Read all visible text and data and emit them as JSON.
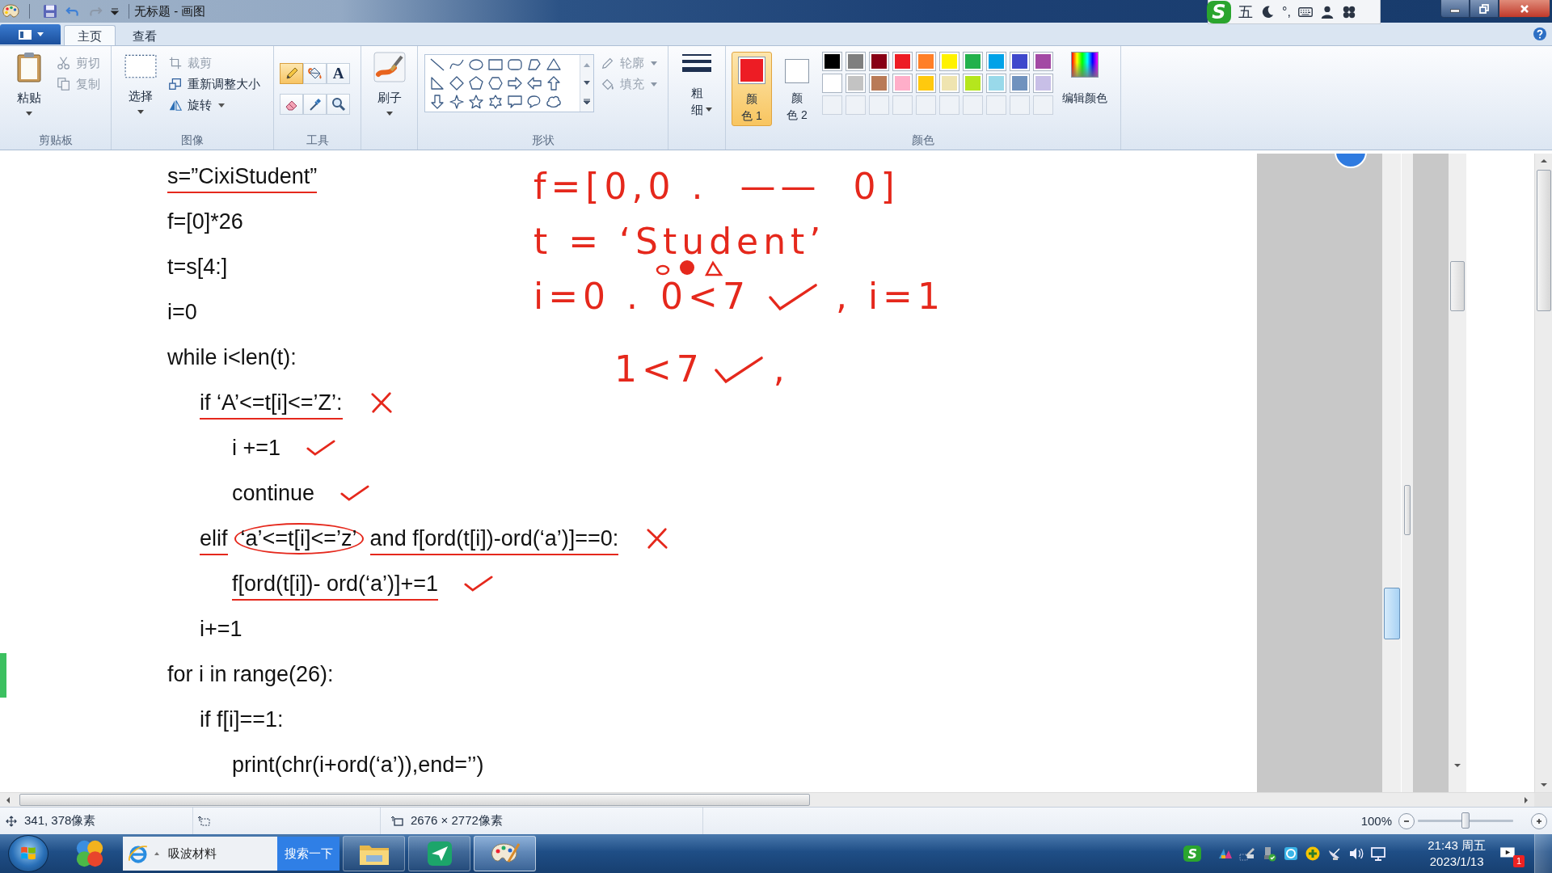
{
  "window": {
    "title": "无标题 - 画图"
  },
  "ime_bar": {
    "logo": "S",
    "mode": "五",
    "punctuation": "°,"
  },
  "tabs": [
    {
      "label": "主页",
      "selected": true
    },
    {
      "label": "查看",
      "selected": false
    }
  ],
  "ribbon": {
    "clipboard": {
      "paste": "粘贴",
      "items": [
        {
          "label": "剪切",
          "disabled": true,
          "dropdown": false
        },
        {
          "label": "复制",
          "disabled": true,
          "dropdown": false
        }
      ],
      "group": "剪贴板"
    },
    "image": {
      "select": "选择",
      "items": [
        {
          "label": "裁剪",
          "disabled": true,
          "dropdown": false
        },
        {
          "label": "重新调整大小",
          "disabled": false,
          "dropdown": false
        },
        {
          "label": "旋转",
          "disabled": false,
          "dropdown": true
        }
      ],
      "group": "图像"
    },
    "tools": {
      "items": [
        {
          "selected": true
        },
        {
          "selected": false
        },
        {
          "label": "A",
          "selected": false
        },
        {
          "selected": false
        },
        {
          "selected": false
        },
        {
          "selected": false
        }
      ],
      "group": "工具"
    },
    "brushes": {
      "label": "刷子"
    },
    "shapes": {
      "items": [
        {
          "label": "轮廓",
          "disabled": true,
          "dropdown": true
        },
        {
          "label": "填充",
          "disabled": true,
          "dropdown": true
        }
      ],
      "group": "形状"
    },
    "size": {
      "label": "粗细"
    },
    "colors": {
      "slots": [
        {
          "label": "颜色 1",
          "color": "#ed1c24",
          "selected": true
        },
        {
          "label": "颜色 2",
          "color": "#ffffff",
          "selected": false
        }
      ],
      "palette": [
        {
          "color": "#000000"
        },
        {
          "color": "#7f7f7f"
        },
        {
          "color": "#880015"
        },
        {
          "color": "#ed1c24"
        },
        {
          "color": "#ff7f27"
        },
        {
          "color": "#fff200"
        },
        {
          "color": "#22b14c"
        },
        {
          "color": "#00a2e8"
        },
        {
          "color": "#3f48cc"
        },
        {
          "color": "#a349a4"
        },
        {
          "color": "#ffffff"
        },
        {
          "color": "#c3c3c3"
        },
        {
          "color": "#b97a57"
        },
        {
          "color": "#ffaec9"
        },
        {
          "color": "#ffc90e"
        },
        {
          "color": "#efe4b0"
        },
        {
          "color": "#b5e61d"
        },
        {
          "color": "#99d9ea"
        },
        {
          "color": "#7092be"
        },
        {
          "color": "#c8bfe7"
        }
      ],
      "edit": "编辑颜色",
      "group": "颜色"
    }
  },
  "canvas": {
    "code": [
      {
        "parts": [
          {
            "kind": "text",
            "text": "s=”CixiStudent”"
          }
        ],
        "underlined": true
      },
      {
        "parts": [
          {
            "kind": "text",
            "text": "f=[0]*26"
          }
        ],
        "underlined": false
      },
      {
        "parts": [
          {
            "kind": "text",
            "text": "t=s[4:]"
          }
        ],
        "underlined": false
      },
      {
        "parts": [
          {
            "kind": "text",
            "text": "i=0"
          }
        ],
        "underlined": false
      },
      {
        "parts": [
          {
            "kind": "text",
            "text": "while i<len(t):"
          }
        ],
        "underlined": false,
        "children": [
          {
            "parts": [
              {
                "kind": "text",
                "text": "if ‘A’<=t[i]<=’Z’:"
              },
              {
                "kind": "cross"
              }
            ],
            "underlined": true,
            "children": [
              {
                "parts": [
                  {
                    "kind": "text",
                    "text": "i +=1"
                  },
                  {
                    "kind": "check"
                  }
                ],
                "underlined": false
              },
              {
                "parts": [
                  {
                    "kind": "text",
                    "text": "continue"
                  },
                  {
                    "kind": "check"
                  }
                ],
                "underlined": false
              }
            ]
          },
          {
            "parts": [
              {
                "kind": "text",
                "text": "elif"
              },
              {
                "kind": "circled",
                "text": "‘a’<=t[i]<=’z’"
              },
              {
                "kind": "text",
                "text": "and f[ord(t[i])-ord(‘a’)]==0:"
              },
              {
                "kind": "cross"
              }
            ],
            "underlined": true,
            "children": [
              {
                "parts": [
                  {
                    "kind": "text",
                    "text": "f[ord(t[i])- ord(‘a’)]+=1"
                  },
                  {
                    "kind": "check"
                  }
                ],
                "underlined": true
              }
            ]
          },
          {
            "parts": [
              {
                "kind": "text",
                "text": "i+=1"
              }
            ],
            "underlined": false
          }
        ]
      },
      {
        "parts": [
          {
            "kind": "text",
            "text": "for i in range(26):"
          }
        ],
        "underlined": false,
        "children": [
          {
            "parts": [
              {
                "kind": "text",
                "text": "if f[i]==1:"
              }
            ],
            "underlined": false,
            "children": [
              {
                "parts": [
                  {
                    "kind": "text",
                    "text": "print(chr(i+ord(‘a’)),end=’’)"
                  }
                ],
                "underlined": false
              }
            ]
          }
        ]
      }
    ],
    "notes": [
      {
        "parts": [
          {
            "kind": "text",
            "text": "f=[0,0 ."
          },
          {
            "kind": "text",
            "text": "——"
          },
          {
            "kind": "text",
            "text": "0]"
          }
        ]
      },
      {
        "parts": [
          {
            "kind": "text",
            "text": "t = ‘Student’"
          }
        ]
      },
      {
        "parts": [
          {
            "kind": "text",
            "text": "i=0 ."
          },
          {
            "kind": "text",
            "text": "0<7"
          },
          {
            "kind": "check"
          },
          {
            "kind": "text",
            "text": ", i=1"
          }
        ]
      },
      {
        "parts": [
          {
            "kind": "text",
            "text": "1<7"
          },
          {
            "kind": "check"
          },
          {
            "kind": "text",
            "text": ","
          }
        ]
      }
    ]
  },
  "status_bar": {
    "cursor": "341, 378像素",
    "canvas_size": "2676 × 2772像素",
    "zoom": "100%",
    "zoom_slider": {
      "level": 0.5
    }
  },
  "taskbar": {
    "search": {
      "value": "吸波材料",
      "button": "搜索一下"
    },
    "apps": [
      {
        "selected": false
      },
      {
        "selected": false
      },
      {
        "selected": true
      }
    ],
    "tray_logo": "S",
    "clock": {
      "time": "21:43 周五",
      "date": "2023/1/13"
    },
    "notifications": "1"
  }
}
